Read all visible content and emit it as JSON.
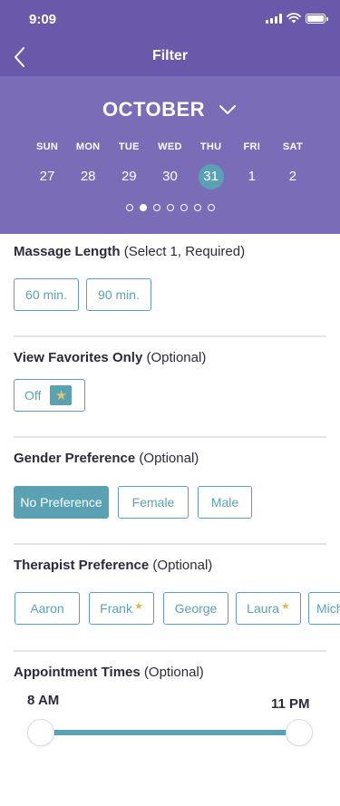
{
  "status_bar": {
    "time": "9:09"
  },
  "header": {
    "title": "Filter"
  },
  "calendar": {
    "month": "OCTOBER",
    "weekdays": [
      "SUN",
      "MON",
      "TUE",
      "WED",
      "THU",
      "FRI",
      "SAT"
    ],
    "dates": [
      "27",
      "28",
      "29",
      "30",
      "31",
      "1",
      "2"
    ],
    "selected_date": "31",
    "page_count": 7,
    "active_page": 2
  },
  "massage_length": {
    "title": "Massage Length",
    "hint": "(Select 1, Required)",
    "options": [
      "60 min.",
      "90 min."
    ]
  },
  "favorites": {
    "title": "View Favorites Only",
    "hint": "(Optional)",
    "toggle_label": "Off"
  },
  "gender": {
    "title": "Gender Preference",
    "hint": "(Optional)",
    "options": [
      "No Preference",
      "Female",
      "Male"
    ],
    "selected": "No Preference"
  },
  "therapist": {
    "title": "Therapist Preference",
    "hint": "(Optional)",
    "options": [
      {
        "name": "Aaron",
        "favorite": false
      },
      {
        "name": "Frank",
        "favorite": true
      },
      {
        "name": "George",
        "favorite": false
      },
      {
        "name": "Laura",
        "favorite": true
      },
      {
        "name": "Mich",
        "favorite": false
      }
    ]
  },
  "appointment_times": {
    "title": "Appointment Times",
    "hint": "(Optional)",
    "start_label": "8 AM",
    "end_label": "11 PM"
  },
  "colors": {
    "header": "#6a59ab",
    "calendar": "#7b6cb8",
    "accent": "#5aa2b3",
    "star": "#e2b84f"
  }
}
